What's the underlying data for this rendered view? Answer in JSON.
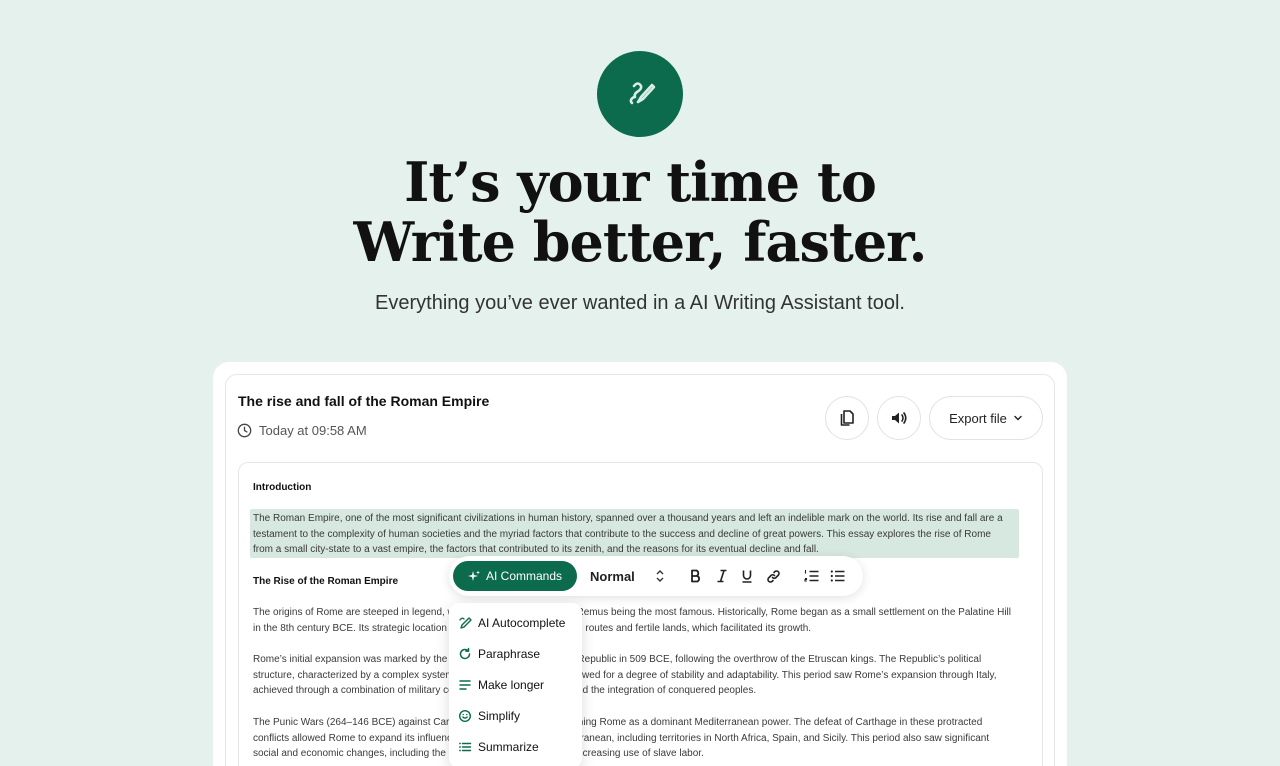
{
  "hero": {
    "title_line1": "It’s your time to",
    "title_line2": "Write better, faster.",
    "subtitle": "Everything you’ve ever wanted in a AI Writing Assistant tool."
  },
  "document": {
    "title": "The rise and fall of the Roman Empire",
    "timestamp": "Today at 09:58 AM",
    "export_label": "Export file"
  },
  "editor": {
    "heading1": "Introduction",
    "para1_l1": "The Roman Empire, one of the most significant civilizations in human history, spanned over a thousand years and left an indelible mark on the world. Its rise and fall are a",
    "para1_l2": "testament to the complexity of human societies and the myriad factors that contribute to the success and decline of great powers. This essay explores the rise of Rome",
    "para1_l3": "from a small city-state to a vast empire, the factors that contributed to its zenith, and the reasons for its eventual decline and fall.",
    "heading2": "The Rise of the Roman Empire",
    "para2_l1": "The origins of Rome are steeped in legend, with the tale of Romulus and Remus being the most famous. Historically, Rome began as a small settlement on the Palatine Hill",
    "para2_l2": "in the 8th century BCE. Its strategic location provided easy access to trade routes and fertile lands, which facilitated its growth.",
    "para3_l1": "Rome’s initial expansion was marked by the establishment of the Roman Republic in 509 BCE, following the overthrow of the Etruscan kings. The Republic’s political",
    "para3_l2": "structure, characterized by a complex system of checks and balances, allowed for a degree of stability and adaptability. This period saw Rome’s expansion through Italy,",
    "para3_l3": "achieved through a combination of military conquest, strategic alliances and the integration of conquered peoples.",
    "para4_l1": "The Punic Wars (264–146 BCE) against Carthage were pivotal in establishing Rome as a dominant Mediterranean power. The defeat of Carthage in these protracted",
    "para4_l2": "conflicts allowed Rome to expand its influence across the western Mediterranean, including territories in North Africa, Spain, and Sicily. This period also saw significant",
    "para4_l3": "social and economic changes, including the rise of large estates and the increasing use of slave labor."
  },
  "toolbar": {
    "ai_label": "AI Commands",
    "style_value": "Normal"
  },
  "menu": {
    "items": [
      "AI Autocomplete",
      "Paraphrase",
      "Make longer",
      "Simplify",
      "Summarize"
    ]
  },
  "colors": {
    "background": "#e5f1ec",
    "accent": "#0b6b4c",
    "highlight": "#d6e8df"
  }
}
